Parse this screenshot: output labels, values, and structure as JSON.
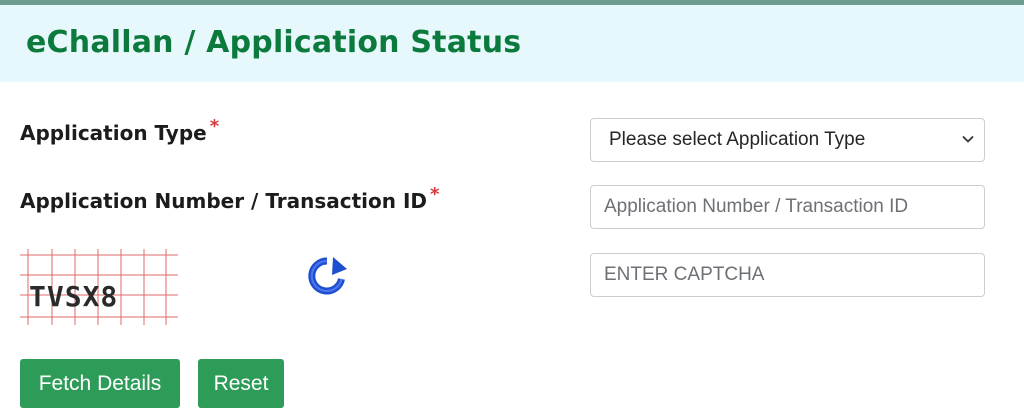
{
  "page": {
    "title": "eChallan / Application Status"
  },
  "form": {
    "application_type": {
      "label": "Application Type",
      "required_marker": "*",
      "selected_text": "Please select Application Type"
    },
    "application_number": {
      "label": "Application Number / Transaction ID",
      "required_marker": "*",
      "placeholder": "Application Number / Transaction ID",
      "value": ""
    },
    "captcha": {
      "image_text": "TVSX8",
      "placeholder": "ENTER CAPTCHA",
      "value": "",
      "refresh_icon": "refresh-icon"
    }
  },
  "buttons": {
    "fetch_label": "Fetch Details",
    "reset_label": "Reset"
  },
  "colors": {
    "title_green": "#0c7a3c",
    "header_bg": "#e6f8fb",
    "button_green": "#2e9c59",
    "required_red": "#d63a3a",
    "refresh_blue": "#1f4fd1"
  }
}
